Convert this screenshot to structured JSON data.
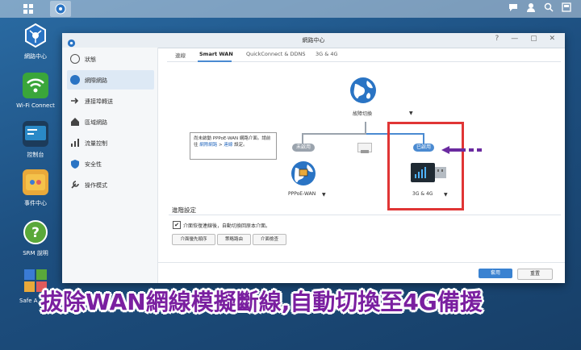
{
  "desktop": {
    "icons": [
      {
        "label": "網路中心"
      },
      {
        "label": "Wi-Fi Connect"
      },
      {
        "label": "控制台"
      },
      {
        "label": "事件中心"
      },
      {
        "label": "SRM 說明"
      },
      {
        "label": "Safe A"
      }
    ]
  },
  "window": {
    "title": "網路中心",
    "buttons": {
      "help": "?",
      "minimize": "—",
      "maximize": "▢",
      "close": "✕"
    }
  },
  "sidebar": {
    "items": [
      {
        "label": "狀態"
      },
      {
        "label": "網際網路"
      },
      {
        "label": "連接埠轉送"
      },
      {
        "label": "區域網路"
      },
      {
        "label": "流量控制"
      },
      {
        "label": "安全性"
      },
      {
        "label": "操作模式"
      }
    ]
  },
  "tabs": [
    {
      "label": "連線"
    },
    {
      "label": "Smart WAN"
    },
    {
      "label": "QuickConnect & DDNS"
    },
    {
      "label": "3G & 4G"
    }
  ],
  "diagram": {
    "failover_label": "故障切換",
    "disabled_tag": "未啟用",
    "enabled_tag": "已啟用",
    "wan_label": "PPPoE-WAN",
    "mobile_label": "3G & 4G",
    "tooltip": {
      "part1": "尚未啟動 PPPoE-WAN 網路介面。請前往 ",
      "link1": "網際網路",
      "part2": " > ",
      "link2": "連線",
      "part3": " 設定。"
    }
  },
  "advanced": {
    "title": "進階設定",
    "checkbox_label": "介面恢復連線後，自動切換回原本介面。",
    "checked": true,
    "buttons": [
      {
        "label": "介面優先順序"
      },
      {
        "label": "策略路由"
      },
      {
        "label": "介面檢查"
      }
    ]
  },
  "footer": {
    "apply": "套用",
    "reset": "重置"
  },
  "caption": "拔除WAN網線模擬斷線,自動切換至4G備援",
  "colors": {
    "accent": "#3a82d1",
    "highlight_box": "#e03535",
    "arrow": "#6a2aa0",
    "caption": "#7a1fa0",
    "enabled_tag": "#4a8ad1",
    "disabled_tag": "#9aa3ad"
  }
}
